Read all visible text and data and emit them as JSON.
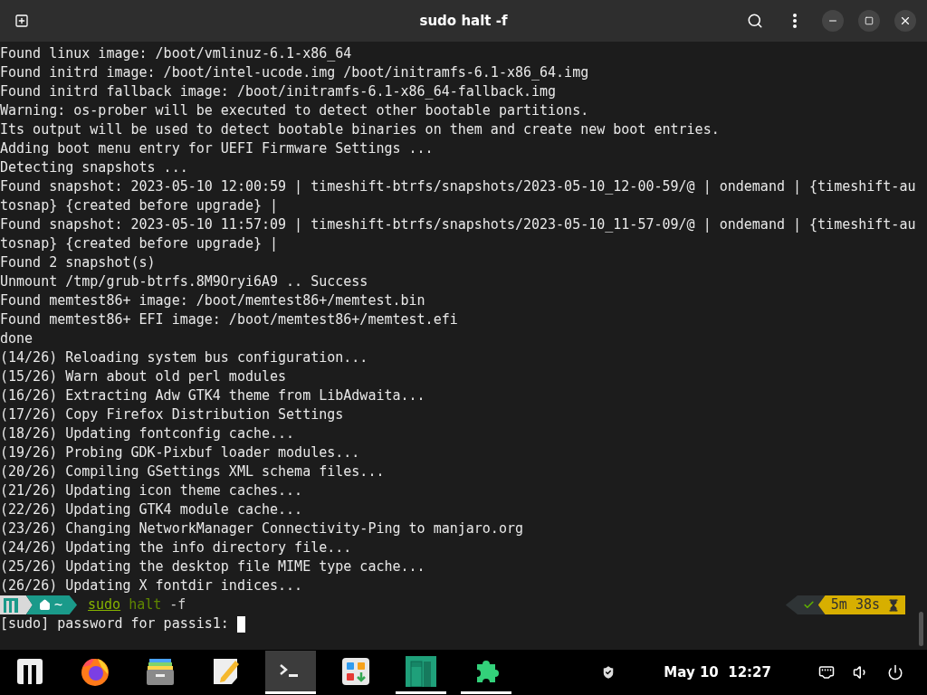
{
  "window": {
    "title": "sudo halt -f"
  },
  "terminal": {
    "lines": [
      "Found linux image: /boot/vmlinuz-6.1-x86_64",
      "Found initrd image: /boot/intel-ucode.img /boot/initramfs-6.1-x86_64.img",
      "Found initrd fallback image: /boot/initramfs-6.1-x86_64-fallback.img",
      "Warning: os-prober will be executed to detect other bootable partitions.",
      "Its output will be used to detect bootable binaries on them and create new boot entries.",
      "Adding boot menu entry for UEFI Firmware Settings ...",
      "Detecting snapshots ...",
      "Found snapshot: 2023-05-10 12:00:59 | timeshift-btrfs/snapshots/2023-05-10_12-00-59/@ | ondemand | {timeshift-au",
      "tosnap} {created before upgrade} |",
      "Found snapshot: 2023-05-10 11:57:09 | timeshift-btrfs/snapshots/2023-05-10_11-57-09/@ | ondemand | {timeshift-au",
      "tosnap} {created before upgrade} |",
      "Found 2 snapshot(s)",
      "Unmount /tmp/grub-btrfs.8M9Oryi6A9 .. Success",
      "Found memtest86+ image: /boot/memtest86+/memtest.bin",
      "Found memtest86+ EFI image: /boot/memtest86+/memtest.efi",
      "done",
      "(14/26) Reloading system bus configuration...",
      "(15/26) Warn about old perl modules",
      "(16/26) Extracting Adw GTK4 theme from LibAdwaita...",
      "(17/26) Copy Firefox Distribution Settings",
      "(18/26) Updating fontconfig cache...",
      "(19/26) Probing GDK-Pixbuf loader modules...",
      "(20/26) Compiling GSettings XML schema files...",
      "(21/26) Updating icon theme caches...",
      "(22/26) Updating GTK4 module cache...",
      "(23/26) Changing NetworkManager Connectivity-Ping to manjaro.org",
      "(24/26) Updating the info directory file...",
      "(25/26) Updating the desktop file MIME type cache...",
      "(26/26) Updating X fontdir indices..."
    ],
    "prompt": {
      "path": "~",
      "command": [
        {
          "text": "sudo",
          "kind": "builtin"
        },
        {
          "text": "halt",
          "kind": "command"
        },
        {
          "text": "-f",
          "kind": "argument"
        }
      ],
      "status_ok": true,
      "duration": "5m 38s"
    },
    "password_prompt": "[sudo] password for passis1:"
  },
  "taskbar": {
    "apps": [
      {
        "kind": "menu",
        "selected": false,
        "running": false
      },
      {
        "kind": "browser",
        "selected": false,
        "running": false
      },
      {
        "kind": "files",
        "selected": false,
        "running": false
      },
      {
        "kind": "editor",
        "selected": false,
        "running": false
      },
      {
        "kind": "terminal",
        "selected": true,
        "running": true
      },
      {
        "kind": "software",
        "selected": false,
        "running": false
      },
      {
        "kind": "welcome",
        "selected": false,
        "running": true
      },
      {
        "kind": "extensions",
        "selected": false,
        "running": true
      }
    ],
    "clock": "May 10  12:27"
  }
}
